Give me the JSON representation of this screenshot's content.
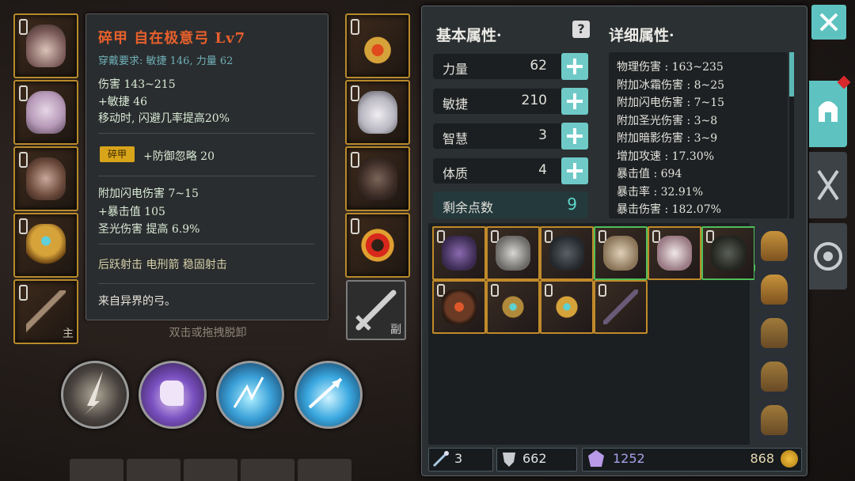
{
  "tooltip": {
    "title": "碎甲 自在极意弓 Lv7",
    "requirement": "穿戴要求:  敏捷 146, 力量 62",
    "lines_a": [
      "伤害  143~215",
      "+敏捷  46",
      "移动时, 闪避几率提高20%"
    ],
    "tag": "碎甲",
    "tag_effect": "+防御忽略  20",
    "lines_b": [
      "附加闪电伤害  7~15",
      "+暴击值  105",
      "圣光伤害  提高  6.9%"
    ],
    "skills_line": "后跃射击    电刑箭    稳固射击",
    "flavor": "来自异界的弓。"
  },
  "hint": "双击或拖拽脱卸",
  "left_slots_badge": "主",
  "weapon_slot_badge": "副",
  "panel": {
    "basic_title": "基本属性·",
    "detail_title": "详细属性·",
    "stats": [
      {
        "label": "力量",
        "value": "62"
      },
      {
        "label": "敏捷",
        "value": "210"
      },
      {
        "label": "智慧",
        "value": "3"
      },
      {
        "label": "体质",
        "value": "4"
      }
    ],
    "remaining_label": "剩余点数",
    "remaining_value": "9",
    "details": [
      "物理伤害 : 163~235",
      "附加冰霜伤害 : 8~25",
      "附加闪电伤害 : 7~15",
      "附加圣光伤害 : 3~8",
      "附加暗影伤害 : 3~9",
      "增加攻速 : 17.30%",
      "暴击值 : 694",
      "暴击率 : 32.91%",
      "暴击伤害 : 182.07%"
    ]
  },
  "resources": {
    "scroll": "3",
    "defense": "662",
    "crystal": "1252",
    "gold": "868"
  }
}
